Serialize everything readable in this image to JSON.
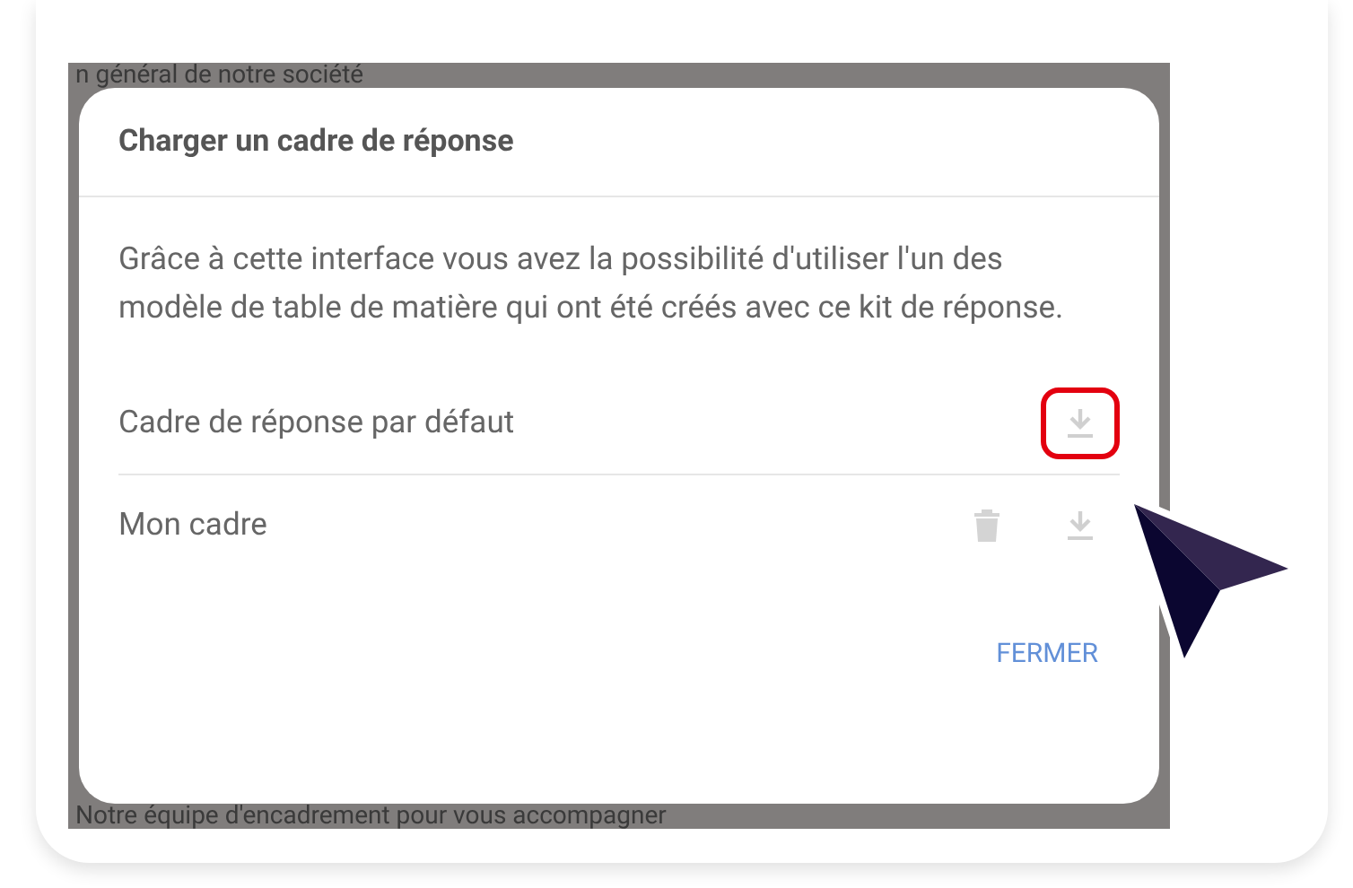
{
  "background": {
    "top_text": "n général de notre société",
    "bottom_text": "Notre équipe d'encadrement pour vous accompagner"
  },
  "dialog": {
    "title": "Charger un cadre de réponse",
    "description": "Grâce à cette interface vous avez la possibilité d'utiliser l'un des modèle de table de matière qui ont été créés avec ce kit de réponse.",
    "items": [
      {
        "label": "Cadre de réponse par défaut",
        "actions": [
          {
            "kind": "download"
          }
        ],
        "highlighted": true
      },
      {
        "label": "Mon cadre",
        "actions": [
          {
            "kind": "delete"
          },
          {
            "kind": "download"
          }
        ],
        "highlighted": false
      }
    ],
    "buttons": [
      "FERMER"
    ]
  }
}
